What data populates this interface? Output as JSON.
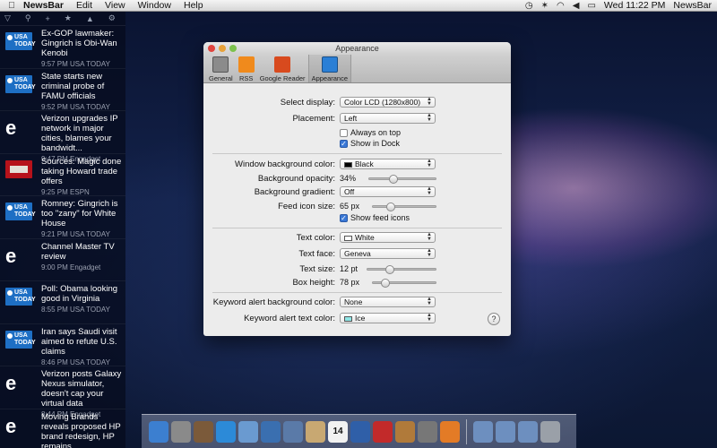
{
  "menubar": {
    "apple": "",
    "app_name": "NewsBar",
    "menus": [
      "Edit",
      "View",
      "Window",
      "Help"
    ],
    "clock": "Wed 11:22 PM",
    "right_app": "NewsBar"
  },
  "sidebar": {
    "items": [
      {
        "source": "usa",
        "title": "Ex-GOP lawmaker: Gingrich is Obi-Wan Kenobi",
        "meta": "9:57 PM USA TODAY"
      },
      {
        "source": "usa",
        "title": "State starts new criminal probe of FAMU officials",
        "meta": "9:52 PM USA TODAY"
      },
      {
        "source": "engadget",
        "title": "Verizon upgrades IP network in major cities, blames your bandwidt...",
        "meta": "9:47 PM Engadget"
      },
      {
        "source": "espn",
        "title": "Sources: Magic done taking Howard trade offers",
        "meta": "9:25 PM ESPN"
      },
      {
        "source": "usa",
        "title": "Romney: Gingrich is too \"zany\" for White House",
        "meta": "9:21 PM USA TODAY"
      },
      {
        "source": "engadget",
        "title": "Channel Master TV review",
        "meta": "9:00 PM Engadget"
      },
      {
        "source": "usa",
        "title": "Poll: Obama looking good in Virginia",
        "meta": "8:55 PM USA TODAY"
      },
      {
        "source": "usa",
        "title": "Iran says Saudi visit aimed to refute U.S. claims",
        "meta": "8:46 PM USA TODAY"
      },
      {
        "source": "engadget",
        "title": "Verizon posts Galaxy Nexus simulator, doesn't cap your virtual data",
        "meta": "8:44 PM Engadget"
      },
      {
        "source": "engadget",
        "title": "Moving Brands reveals proposed HP brand redesign, HP remains...",
        "meta": ""
      }
    ],
    "icon_labels": {
      "usa": "USA TODAY"
    }
  },
  "window": {
    "title": "Appearance",
    "tabs": [
      {
        "label": "General"
      },
      {
        "label": "RSS"
      },
      {
        "label": "Google Reader"
      },
      {
        "label": "Appearance"
      }
    ],
    "select_display": {
      "label": "Select display:",
      "value": "Color LCD (1280x800)"
    },
    "placement": {
      "label": "Placement:",
      "value": "Left"
    },
    "always_on_top": {
      "label": "Always on top",
      "checked": false
    },
    "show_in_dock": {
      "label": "Show in Dock",
      "checked": true
    },
    "window_bg_color": {
      "label": "Window background color:",
      "value": "Black",
      "swatch": "#000000"
    },
    "bg_opacity": {
      "label": "Background opacity:",
      "value": "34%",
      "level": 0.34
    },
    "bg_gradient": {
      "label": "Background gradient:",
      "value": "Off"
    },
    "feed_icon_size": {
      "label": "Feed icon size:",
      "value": "65 px",
      "level": 0.25
    },
    "show_feed_icons": {
      "label": "Show feed icons",
      "checked": true
    },
    "text_color": {
      "label": "Text color:",
      "value": "White",
      "swatch": "#ffffff"
    },
    "text_face": {
      "label": "Text face:",
      "value": "Geneva"
    },
    "text_size": {
      "label": "Text size:",
      "value": "12 pt",
      "level": 0.3
    },
    "box_height": {
      "label": "Box height:",
      "value": "78 px",
      "level": 0.15
    },
    "keyword_bg": {
      "label": "Keyword alert background color:",
      "value": "None"
    },
    "keyword_text": {
      "label": "Keyword alert text color:",
      "value": "Ice",
      "swatch": "#8fe6e6"
    },
    "help": "?"
  },
  "dock": {
    "calendar_day": "14"
  }
}
